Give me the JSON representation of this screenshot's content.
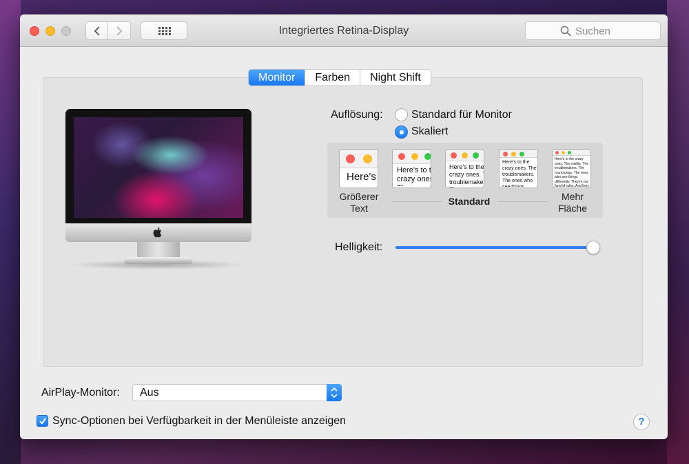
{
  "window": {
    "title": "Integriertes Retina-Display"
  },
  "search": {
    "placeholder": "Suchen"
  },
  "tabs": [
    {
      "label": "Monitor",
      "active": true
    },
    {
      "label": "Farben",
      "active": false
    },
    {
      "label": "Night Shift",
      "active": false
    }
  ],
  "resolution": {
    "label": "Auflösung:",
    "options": [
      {
        "label": "Standard für Monitor",
        "selected": false
      },
      {
        "label": "Skaliert",
        "selected": true
      }
    ],
    "scale_left_label_line1": "Größerer",
    "scale_left_label_line2": "Text",
    "scale_middle_label": "Standard",
    "scale_right_label_line1": "Mehr",
    "scale_right_label_line2": "Fläche",
    "thumbnails": [
      {
        "text": "Here's"
      },
      {
        "text": "Here's to the crazy ones. The troublemakers."
      },
      {
        "text": "Here's to the crazy ones. The troublemakers. The ones who see things"
      },
      {
        "text": "Here's to the crazy ones. The troublemakers. The ones who see things differently. They're not fond of rules. And they have no respect"
      },
      {
        "text": "Here's to the crazy ones. The misfits. The troublemakers. The round pegs. The ones who see things differently. They're not fond of rules. And they have no respect for the status quo. You can quote them, disagree with them. About the only thing you can't do is ignore them. Because they change things."
      }
    ]
  },
  "brightness": {
    "label": "Helligkeit:",
    "value": 1.0
  },
  "airplay": {
    "label": "AirPlay-Monitor:",
    "value": "Aus"
  },
  "sync": {
    "label": "Sync-Optionen bei Verfügbarkeit in der Menüleiste anzeigen",
    "checked": true
  },
  "help": {
    "label": "?"
  },
  "colors": {
    "accent": "#1b78f0",
    "close": "#fc5f57",
    "minimize": "#fdbc2e",
    "zoom": "#c9c9c9"
  }
}
